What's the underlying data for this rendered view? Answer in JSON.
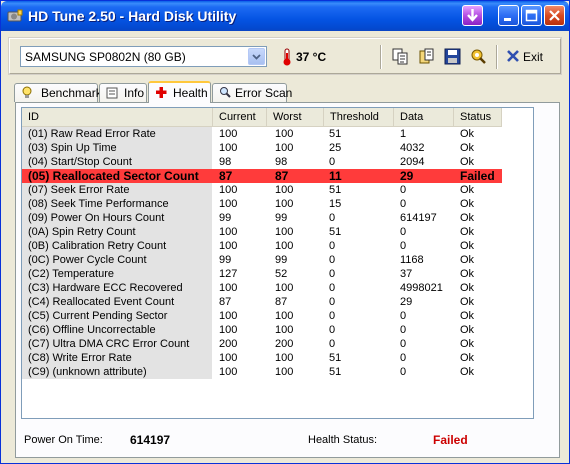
{
  "window": {
    "title": "HD Tune 2.50 - Hard Disk Utility"
  },
  "toolbar": {
    "drive": "SAMSUNG SP0802N (80 GB)",
    "temperature": "37 °C",
    "exit_label": "Exit"
  },
  "tabs": [
    {
      "label": "Benchmark",
      "icon": "lightbulb-icon"
    },
    {
      "label": "Info",
      "icon": "info-icon"
    },
    {
      "label": "Health",
      "icon": "red-cross-icon",
      "active": true
    },
    {
      "label": "Error Scan",
      "icon": "magnifier-icon"
    }
  ],
  "table": {
    "columns": [
      "ID",
      "Current",
      "Worst",
      "Threshold",
      "Data",
      "Status"
    ],
    "rows": [
      [
        "(01) Raw Read Error Rate",
        "100",
        "100",
        "51",
        "1",
        "Ok"
      ],
      [
        "(03) Spin Up Time",
        "100",
        "100",
        "25",
        "4032",
        "Ok"
      ],
      [
        "(04) Start/Stop Count",
        "98",
        "98",
        "0",
        "2094",
        "Ok"
      ],
      [
        "(05) Reallocated Sector Count",
        "87",
        "87",
        "11",
        "29",
        "Failed"
      ],
      [
        "(07) Seek Error Rate",
        "100",
        "100",
        "51",
        "0",
        "Ok"
      ],
      [
        "(08) Seek Time Performance",
        "100",
        "100",
        "15",
        "0",
        "Ok"
      ],
      [
        "(09) Power On Hours Count",
        "99",
        "99",
        "0",
        "614197",
        "Ok"
      ],
      [
        "(0A) Spin Retry Count",
        "100",
        "100",
        "51",
        "0",
        "Ok"
      ],
      [
        "(0B) Calibration Retry Count",
        "100",
        "100",
        "0",
        "0",
        "Ok"
      ],
      [
        "(0C) Power Cycle Count",
        "99",
        "99",
        "0",
        "1168",
        "Ok"
      ],
      [
        "(C2) Temperature",
        "127",
        "52",
        "0",
        "37",
        "Ok"
      ],
      [
        "(C3) Hardware ECC Recovered",
        "100",
        "100",
        "0",
        "4998021",
        "Ok"
      ],
      [
        "(C4) Reallocated Event Count",
        "87",
        "87",
        "0",
        "29",
        "Ok"
      ],
      [
        "(C5) Current Pending Sector",
        "100",
        "100",
        "0",
        "0",
        "Ok"
      ],
      [
        "(C6) Offline Uncorrectable",
        "100",
        "100",
        "0",
        "0",
        "Ok"
      ],
      [
        "(C7) Ultra DMA CRC Error Count",
        "200",
        "200",
        "0",
        "0",
        "Ok"
      ],
      [
        "(C8) Write Error Rate",
        "100",
        "100",
        "51",
        "0",
        "Ok"
      ],
      [
        "(C9) (unknown attribute)",
        "100",
        "100",
        "51",
        "0",
        "Ok"
      ]
    ]
  },
  "footer": {
    "power_on_label": "Power On Time:",
    "power_on_value": "614197",
    "health_label": "Health Status:",
    "health_value": "Failed"
  },
  "colors": {
    "failed_row": "#ff3b3b",
    "failed_text": "#cc0000",
    "title_bar": "#0554e3",
    "tab_highlight": "#ffc83c"
  }
}
